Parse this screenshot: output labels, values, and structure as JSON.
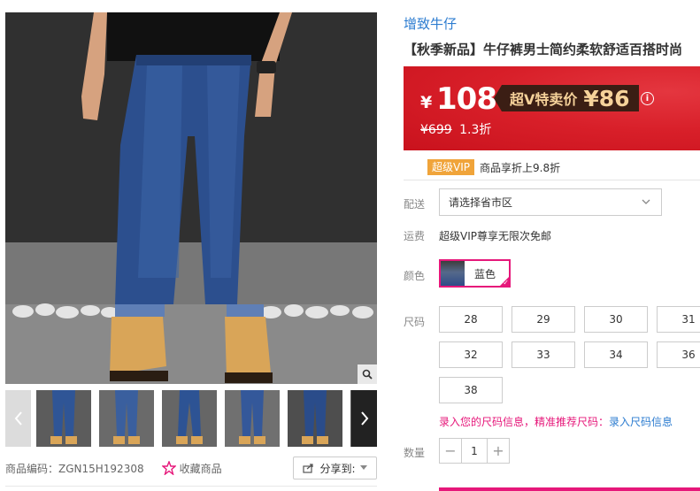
{
  "gallery": {
    "product_code_label": "商品编码：ZGN15H192308",
    "favorite_label": "收藏商品",
    "share_label": "分享到:",
    "thumbnail_count": 6
  },
  "product": {
    "brand": "增致牛仔",
    "title": "【秋季新品】牛仔裤男士简约柔软舒适百搭时尚"
  },
  "price": {
    "currency_symbol": "¥",
    "current": "108",
    "vip_label": "超V特卖价",
    "vip_price": "¥86",
    "info_icon_glyph": "i",
    "original": "¥699",
    "discount": "1.3折"
  },
  "vip": {
    "badge": "超级VIP",
    "text": "商品享折上9.8折"
  },
  "delivery": {
    "label": "配送",
    "placeholder": "请选择省市区"
  },
  "shipping": {
    "label": "运费",
    "text": "超级VIP尊享无限次免邮"
  },
  "color": {
    "label": "颜色",
    "selected": "蓝色"
  },
  "size": {
    "label": "尺码",
    "options": [
      "28",
      "29",
      "30",
      "31",
      "32",
      "33",
      "34",
      "36",
      "38"
    ],
    "note_prompt": "录入您的尺码信息，精准推荐尺码：",
    "note_link": "录入尺码信息"
  },
  "quantity": {
    "label": "数量",
    "minus": "−",
    "value": "1",
    "plus": "+"
  },
  "colors": {
    "brand_link": "#2c7cd0",
    "price_red": "#d81f29",
    "accent_pink": "#e6177a",
    "vip_gold": "#f0a43a"
  }
}
